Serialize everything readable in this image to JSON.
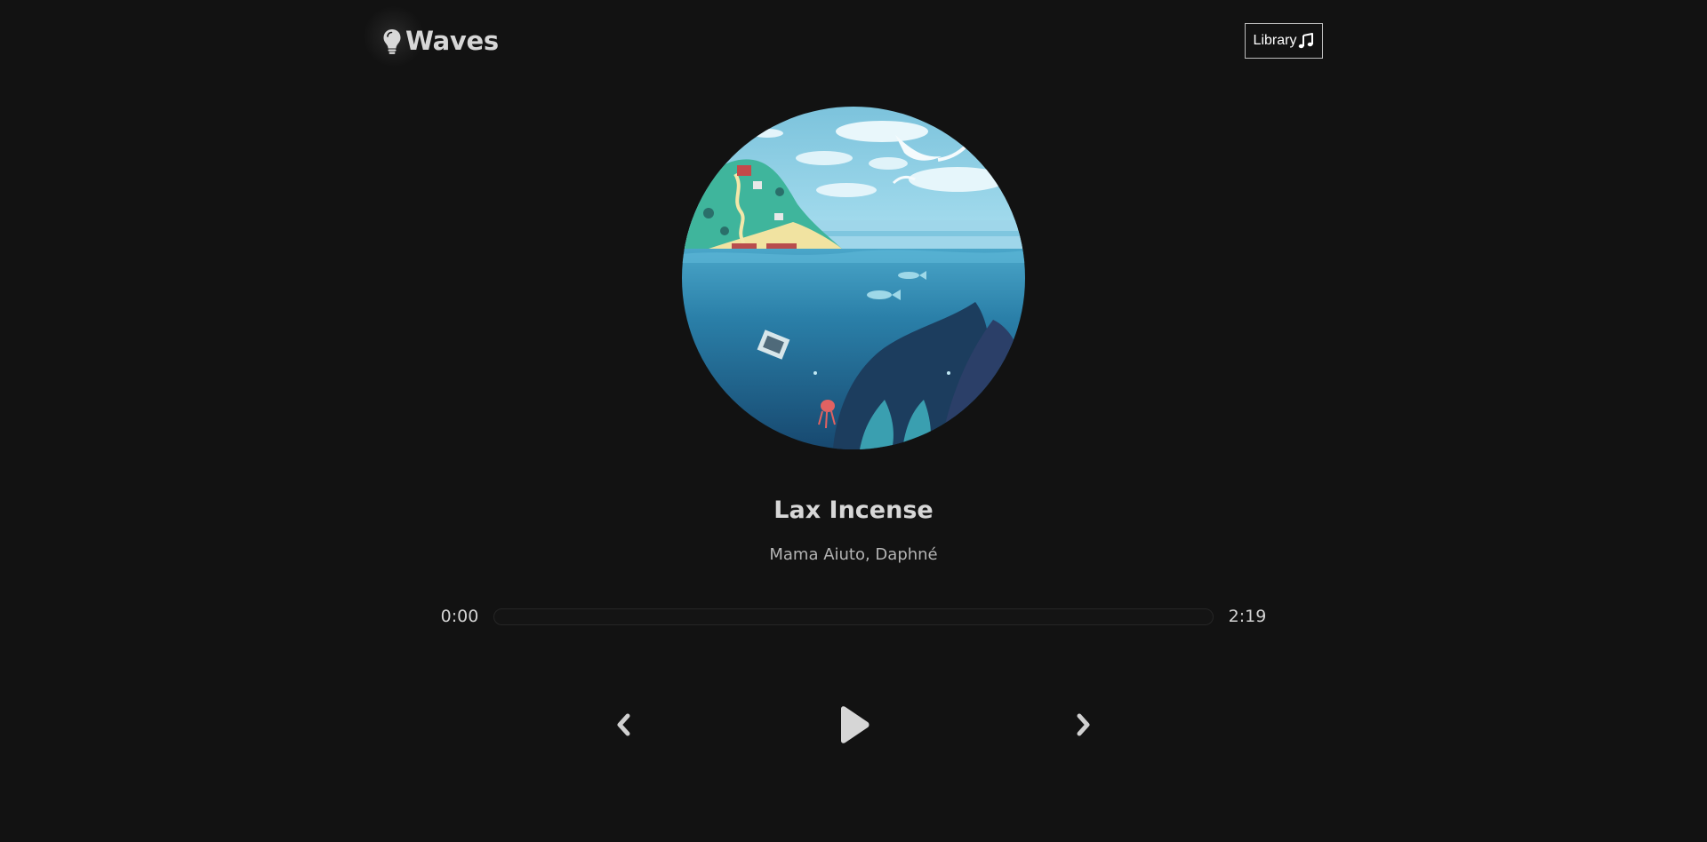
{
  "header": {
    "logo_text": "Waves",
    "logo_icon": "lightbulb-icon",
    "library_label": "Library",
    "library_icon": "music-note-icon"
  },
  "song": {
    "title": "Lax Incense",
    "artist": "Mama Aiuto, Daphné",
    "cover_art": "circular album artwork: island with houses above sea, birds in sky, underwater scene with fish and coral"
  },
  "player": {
    "current_time": "0:00",
    "duration": "2:19",
    "progress": 0,
    "prev_icon": "chevron-left-icon",
    "play_icon": "play-icon",
    "next_icon": "chevron-right-icon"
  },
  "colors": {
    "background": "#121212",
    "text": "#d9d9d9",
    "muted_text": "#b3b3b3",
    "sea": "#1f6f96",
    "sky": "#7fc6de"
  }
}
